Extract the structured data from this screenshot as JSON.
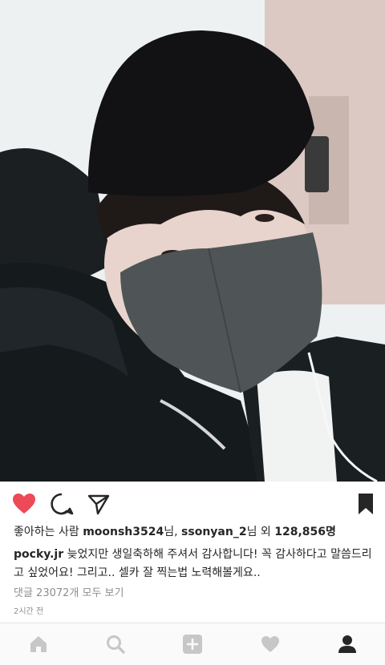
{
  "post": {
    "likes_prefix": "좋아하는 사람 ",
    "liker_1": "moonsh3524",
    "liker_1_suffix": "님, ",
    "liker_2": "ssonyan_2",
    "liker_2_suffix": "님 외 ",
    "likes_count": "128,856",
    "likes_count_suffix": "명",
    "username": "pocky.jr",
    "caption_text": " 늦었지만 생일축하해 주셔서 감사합니다! 꼭 감사하다고 말씀드리고 싶었어요! 그리고.. 셀카 잘 찍는법 노력해볼게요..",
    "view_comments": "댓글 23072개 모두 보기",
    "time_ago": "2시간 전"
  },
  "actions": {
    "liked": true,
    "like_color": "#ed4956"
  },
  "icons": {
    "like": "heart-icon",
    "comment": "comment-icon",
    "share": "share-icon",
    "save": "bookmark-icon"
  },
  "nav": {
    "items": [
      "home-icon",
      "search-icon",
      "add-icon",
      "heart-icon",
      "profile-icon"
    ],
    "active": "profile-icon"
  }
}
